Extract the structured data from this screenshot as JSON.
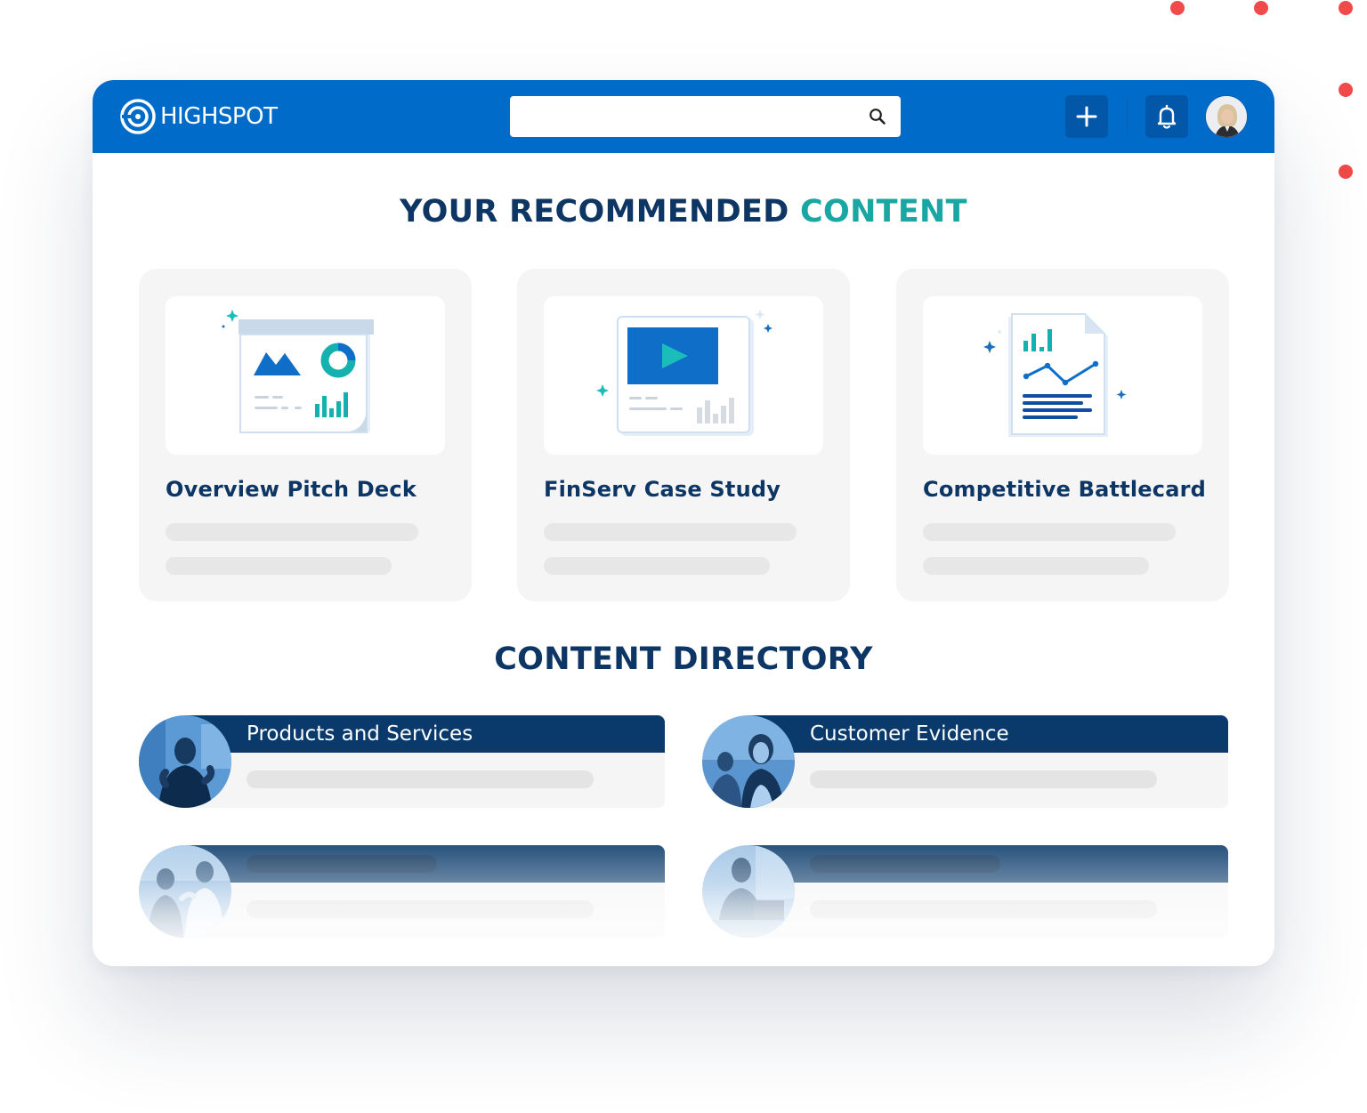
{
  "app": {
    "brand": "HIGHSPOT"
  },
  "search": {
    "value": "",
    "placeholder": ""
  },
  "header": {
    "icons": [
      "search-icon",
      "plus-icon",
      "bell-icon",
      "user-avatar"
    ]
  },
  "recommended": {
    "heading_part1": "YOUR RECOMMENDED ",
    "heading_part2": "CONTENT",
    "cards": [
      {
        "title": "Overview Pitch Deck",
        "illustration": "presentation-icon"
      },
      {
        "title": "FinServ Case Study",
        "illustration": "video-icon"
      },
      {
        "title": "Competitive Battlecard",
        "illustration": "report-icon"
      }
    ]
  },
  "directory": {
    "heading": "CONTENT DIRECTORY",
    "items": [
      {
        "label": "Products and Services"
      },
      {
        "label": "Customer Evidence"
      },
      {
        "label": ""
      },
      {
        "label": ""
      }
    ]
  },
  "colors": {
    "topbar": "#016bc9",
    "navy": "#0d3664",
    "teal": "#1aa6a3",
    "accent_dots": "#f04a4a"
  }
}
